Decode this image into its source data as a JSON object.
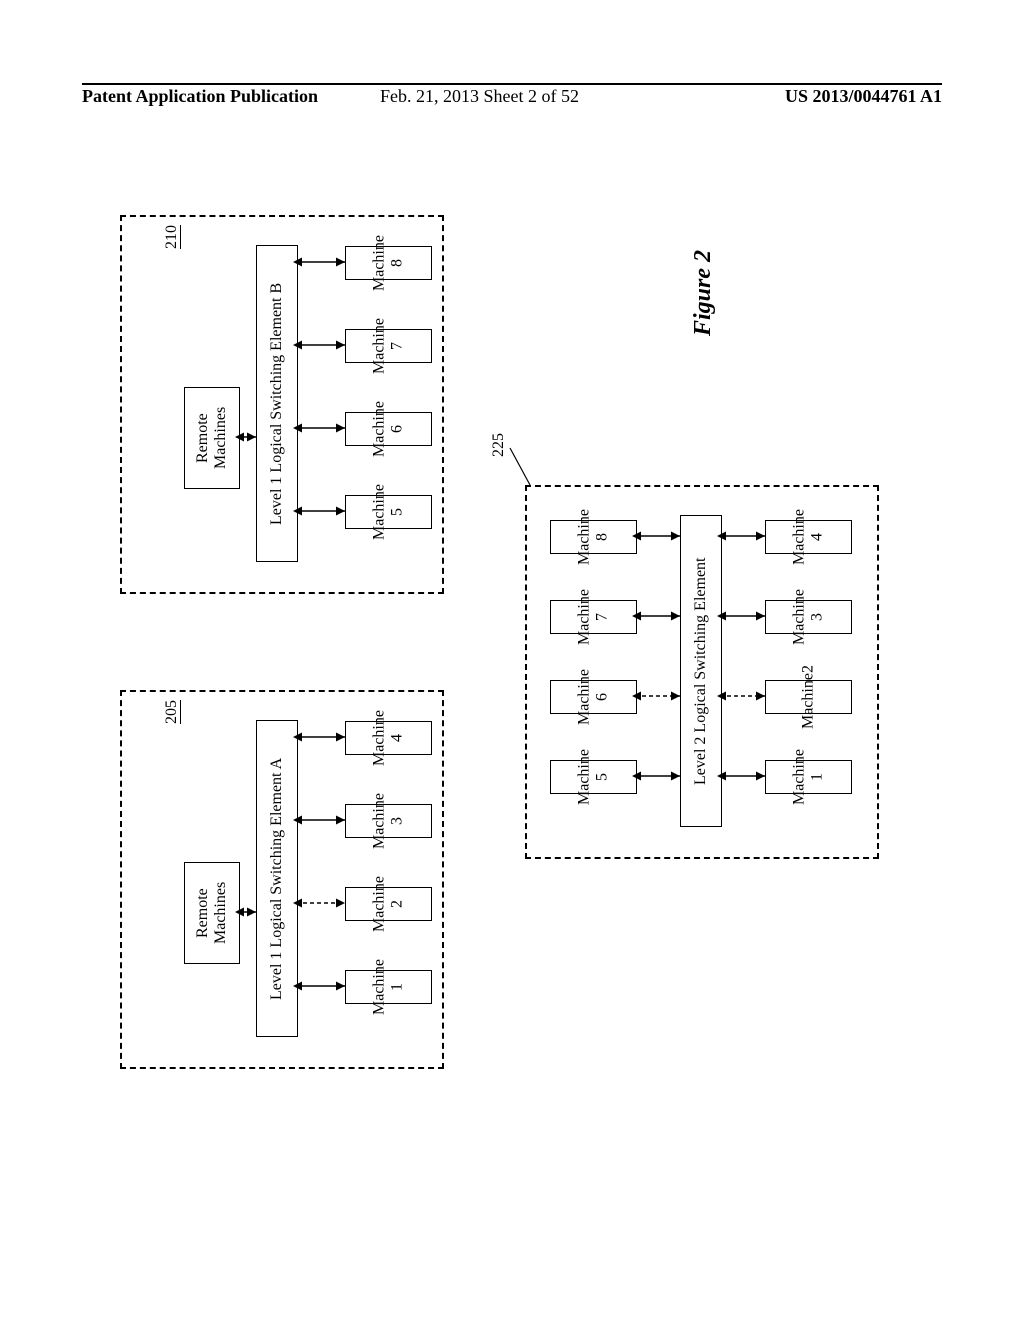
{
  "header": {
    "left": "Patent Application Publication",
    "mid": "Feb. 21, 2013  Sheet 2 of 52",
    "right": "US 2013/0044761 A1"
  },
  "figure_label": "Figure 2",
  "refs": {
    "r205": "205",
    "r210": "210",
    "r225": "225"
  },
  "blocks": {
    "remote_a": "Remote\nMachines",
    "remote_b": "Remote\nMachines",
    "lse_a": "Level 1 Logical Switching Element A",
    "lse_b": "Level 1 Logical Switching Element B",
    "lse_2": "Level 2 Logical Switching Element",
    "m1": "Machine 1",
    "m2": "Machine 2",
    "m3": "Machine 3",
    "m4": "Machine 4",
    "m5": "Machine 5",
    "m6": "Machine 6",
    "m7": "Machine 7",
    "m8": "Machine 8",
    "m1b": "Machine 1",
    "m2b": "Machine2",
    "m3b": "Machine 3",
    "m4b": "Machine 4",
    "m5b": "Machine 5",
    "m6b": "Machine 6",
    "m7b": "Machine 7",
    "m8b": "Machine 8"
  }
}
